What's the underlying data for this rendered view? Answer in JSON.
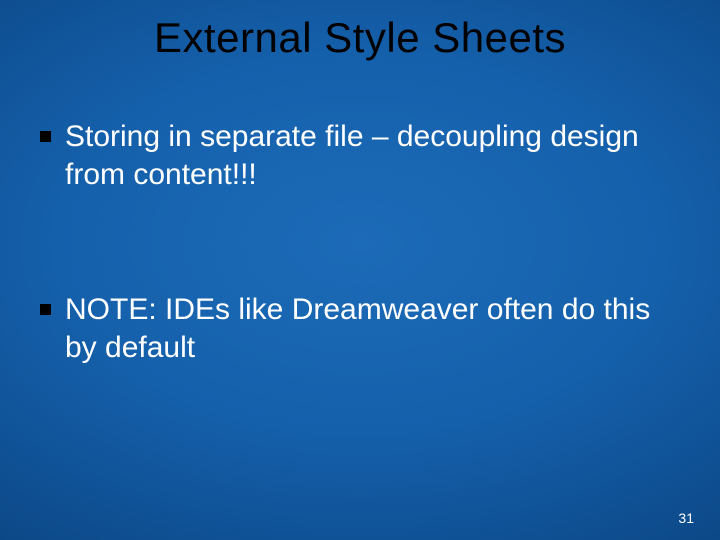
{
  "title": "External Style Sheets",
  "bullets": [
    {
      "text": "Storing in separate file – decoupling design from content!!!"
    },
    {
      "text": "NOTE: IDEs like Dreamweaver often do this by default"
    }
  ],
  "page_number": "31"
}
